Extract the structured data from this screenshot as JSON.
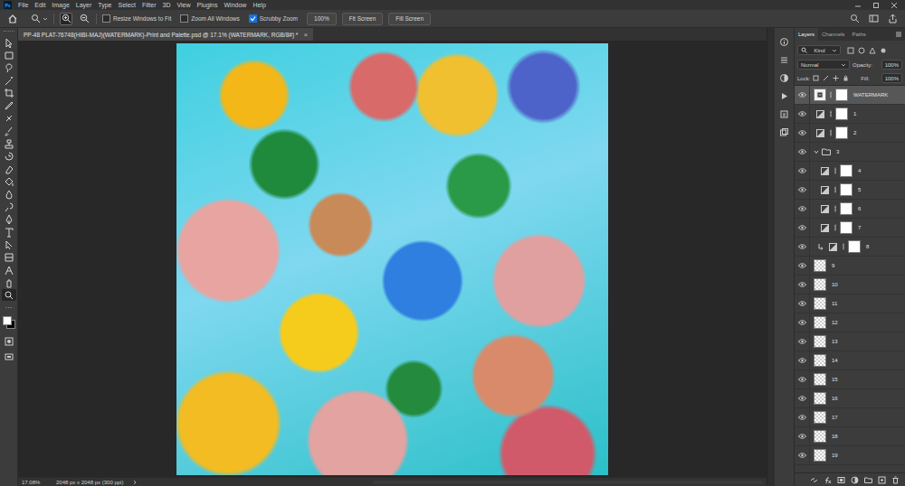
{
  "app": {
    "logo": "Ps"
  },
  "menu": [
    "File",
    "Edit",
    "Image",
    "Layer",
    "Type",
    "Select",
    "Filter",
    "3D",
    "View",
    "Plugins",
    "Window",
    "Help"
  ],
  "options_bar": {
    "zoom_modes": [
      {
        "selected": true
      },
      {
        "selected": false
      }
    ],
    "checkboxes": [
      {
        "label": "Resize Windows to Fit",
        "checked": false
      },
      {
        "label": "Zoom All Windows",
        "checked": false
      },
      {
        "label": "Scrubby Zoom",
        "checked": true
      }
    ],
    "buttons": [
      "100%",
      "Fit Screen",
      "Fill Screen"
    ]
  },
  "document_tab": {
    "title": "PP-48 PLAT-76748(HIBI-MAJ)(WATERMARK)-Print and Palette.psd @ 17.1% (WATERMARK, RGB/8#) *",
    "close": "×"
  },
  "tools": [
    {
      "selected": false
    },
    {
      "selected": false
    },
    {
      "selected": false
    },
    {
      "selected": false
    },
    {
      "selected": false
    },
    {
      "selected": false
    },
    {
      "selected": false
    },
    {
      "selected": false
    },
    {
      "selected": false
    },
    {
      "selected": false
    },
    {
      "selected": false
    },
    {
      "selected": false
    },
    {
      "selected": false
    },
    {
      "selected": false
    },
    {
      "selected": false
    },
    {
      "selected": false
    },
    {
      "selected": false
    },
    {
      "selected": false
    },
    {
      "selected": false
    },
    {
      "selected": false
    },
    {
      "selected": true
    }
  ],
  "tools_more": "···",
  "layers_panel": {
    "tabs": [
      {
        "label": "Layers",
        "selected": true
      },
      {
        "label": "Channels",
        "selected": false
      },
      {
        "label": "Paths",
        "selected": false
      }
    ],
    "filter": "Kind",
    "blend_mode": "Normal",
    "opacity_label": "Opacity:",
    "opacity": "100%",
    "lock_label": "Lock:",
    "fill_label": "Fill:",
    "fill": "100%",
    "layers": [
      {
        "name": "WATERMARK",
        "kind": "smart",
        "visible": true,
        "selected": true,
        "has_mask": true,
        "in_group": false,
        "clipped": false
      },
      {
        "name": "1",
        "kind": "adjustment",
        "visible": true,
        "selected": false,
        "has_mask": true,
        "in_group": false,
        "clipped": false
      },
      {
        "name": "2",
        "kind": "adjustment",
        "visible": true,
        "selected": false,
        "has_mask": true,
        "in_group": false,
        "clipped": false
      },
      {
        "name": "3",
        "kind": "group",
        "visible": true,
        "selected": false,
        "has_mask": false,
        "in_group": false,
        "clipped": false,
        "expanded": true
      },
      {
        "name": "4",
        "kind": "adjustment",
        "visible": true,
        "selected": false,
        "has_mask": true,
        "in_group": true,
        "clipped": false
      },
      {
        "name": "5",
        "kind": "adjustment",
        "visible": true,
        "selected": false,
        "has_mask": true,
        "in_group": true,
        "clipped": false
      },
      {
        "name": "6",
        "kind": "adjustment",
        "visible": true,
        "selected": false,
        "has_mask": true,
        "in_group": true,
        "clipped": false
      },
      {
        "name": "7",
        "kind": "adjustment",
        "visible": true,
        "selected": false,
        "has_mask": true,
        "in_group": true,
        "clipped": false
      },
      {
        "name": "8",
        "kind": "adjustment",
        "visible": true,
        "selected": false,
        "has_mask": true,
        "in_group": true,
        "clipped": true
      },
      {
        "name": "9",
        "kind": "pixel",
        "visible": true,
        "selected": false,
        "has_mask": false,
        "in_group": false,
        "clipped": false
      },
      {
        "name": "10",
        "kind": "pixel",
        "visible": true,
        "selected": false,
        "has_mask": false,
        "in_group": false,
        "clipped": false
      },
      {
        "name": "11",
        "kind": "pixel",
        "visible": true,
        "selected": false,
        "has_mask": false,
        "in_group": false,
        "clipped": false
      },
      {
        "name": "12",
        "kind": "pixel",
        "visible": true,
        "selected": false,
        "has_mask": false,
        "in_group": false,
        "clipped": false
      },
      {
        "name": "13",
        "kind": "pixel",
        "visible": true,
        "selected": false,
        "has_mask": false,
        "in_group": false,
        "clipped": false
      },
      {
        "name": "14",
        "kind": "pixel",
        "visible": true,
        "selected": false,
        "has_mask": false,
        "in_group": false,
        "clipped": false
      },
      {
        "name": "15",
        "kind": "pixel",
        "visible": true,
        "selected": false,
        "has_mask": false,
        "in_group": false,
        "clipped": false
      },
      {
        "name": "16",
        "kind": "pixel",
        "visible": true,
        "selected": false,
        "has_mask": false,
        "in_group": false,
        "clipped": false
      },
      {
        "name": "17",
        "kind": "pixel",
        "visible": true,
        "selected": false,
        "has_mask": false,
        "in_group": false,
        "clipped": false
      },
      {
        "name": "18",
        "kind": "pixel",
        "visible": true,
        "selected": false,
        "has_mask": false,
        "in_group": false,
        "clipped": false
      },
      {
        "name": "19",
        "kind": "pixel",
        "visible": true,
        "selected": false,
        "has_mask": false,
        "in_group": false,
        "clipped": false
      }
    ]
  },
  "status_bar": {
    "zoom": "17.08%",
    "doc_info": "2048 px x 2048 px (300 ppi)"
  }
}
